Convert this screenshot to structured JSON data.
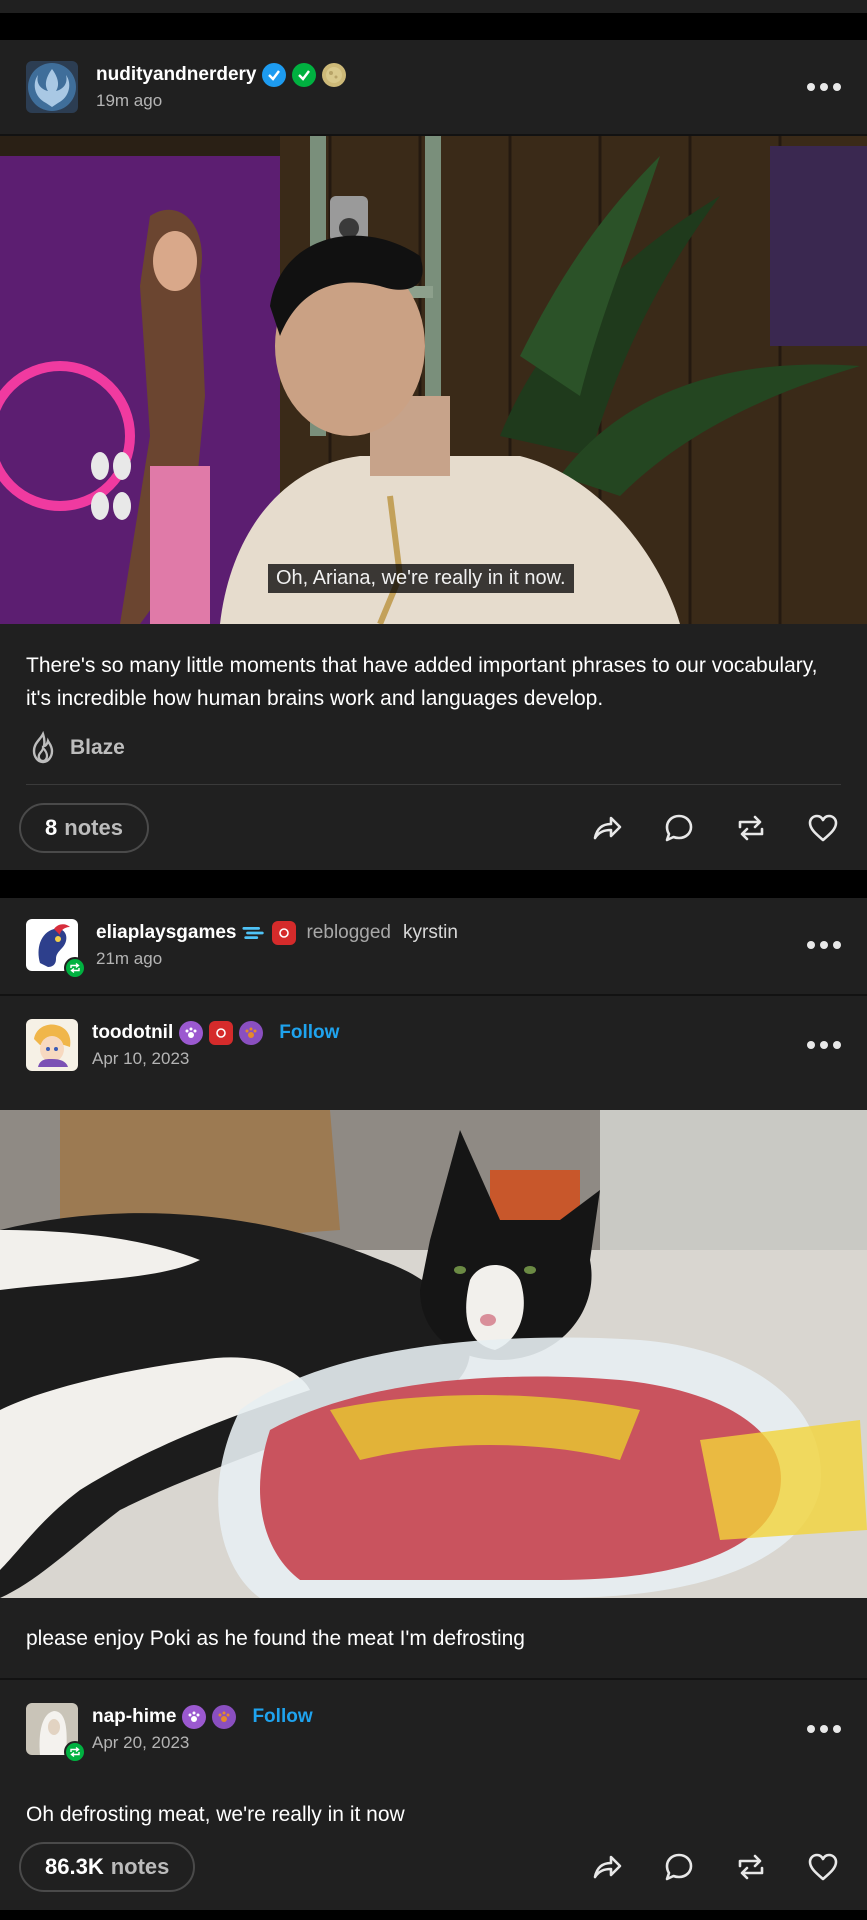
{
  "post1": {
    "blog": "nudityandnerdery",
    "time": "19m ago",
    "subtitle": "Oh, Ariana, we're really in it now.",
    "text": "There's so many little moments that have added important phrases to our vocabulary, it's incredible how human brains work and languages develop.",
    "blaze_label": "Blaze",
    "notes_count": "8",
    "notes_label": "notes",
    "badges": [
      "verified-icon",
      "green-check-icon",
      "moon-icon"
    ]
  },
  "post2": {
    "reblogger": "eliaplaysgames",
    "reblog_word": "reblogged",
    "reblog_source": "kyrstin",
    "time": "21m ago",
    "trail": [
      {
        "blog": "toodotnil",
        "follow": "Follow",
        "date": "Apr 10, 2023",
        "text": "please enjoy Poki as he found the meat I'm defrosting"
      },
      {
        "blog": "nap-hime",
        "follow": "Follow",
        "date": "Apr 20, 2023",
        "text": "Oh defrosting meat, we're really in it now"
      }
    ],
    "notes_count": "86.3K",
    "notes_label": "notes"
  },
  "colors": {
    "background": "#000000",
    "card": "#202020",
    "follow": "#1fa3ee",
    "reblog_green": "#00b140"
  }
}
